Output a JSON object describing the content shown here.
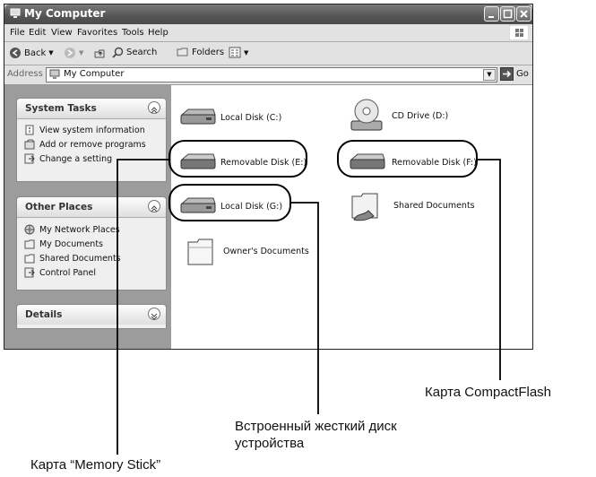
{
  "window": {
    "title": "My Computer",
    "menu": [
      "File",
      "Edit",
      "View",
      "Favorites",
      "Tools",
      "Help"
    ],
    "toolbar": {
      "back": "Back",
      "search": "Search",
      "folders": "Folders"
    },
    "address": {
      "label": "Address",
      "value": "My Computer",
      "go": "Go"
    }
  },
  "sidebar": {
    "system_tasks": {
      "title": "System Tasks",
      "items": [
        "View system information",
        "Add or remove programs",
        "Change a setting"
      ]
    },
    "other_places": {
      "title": "Other Places",
      "items": [
        "My Network Places",
        "My Documents",
        "Shared Documents",
        "Control Panel"
      ]
    },
    "details": {
      "title": "Details"
    }
  },
  "drives": [
    {
      "label": "Local Disk (C:)",
      "icon": "hard-disk-icon"
    },
    {
      "label": "CD Drive (D:)",
      "icon": "cd-drive-icon"
    },
    {
      "label": "Removable Disk (E:)",
      "icon": "removable-disk-icon"
    },
    {
      "label": "Removable Disk (F:)",
      "icon": "removable-disk-icon"
    },
    {
      "label": "Local Disk (G:)",
      "icon": "hard-disk-icon"
    },
    {
      "label": "Shared Documents",
      "icon": "shared-folder-icon"
    },
    {
      "label": "Owner's Documents",
      "icon": "folder-icon"
    }
  ],
  "callouts": {
    "compactflash": "Карта CompactFlash",
    "builtin_line1": "Встроенный жесткий диск",
    "builtin_line2": "устройства",
    "memory_stick": "Карта “Memory Stick”"
  }
}
